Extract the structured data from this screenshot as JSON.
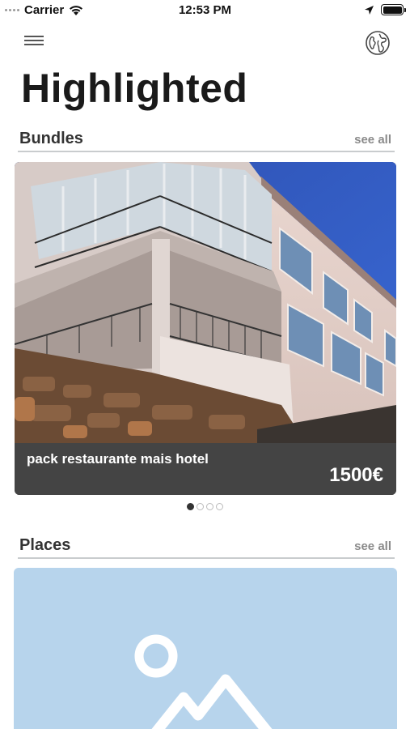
{
  "status_bar": {
    "carrier": "Carrier",
    "time": "12:53 PM"
  },
  "nav": {
    "menu_icon": "hamburger-menu-icon",
    "globe_icon": "globe-icon"
  },
  "page": {
    "title": "Highlighted"
  },
  "bundles": {
    "title": "Bundles",
    "see_all": "see all",
    "items": [
      {
        "name": "pack restaurante mais hotel",
        "price": "1500€"
      }
    ],
    "pager": {
      "count": 4,
      "active": 0
    }
  },
  "places": {
    "title": "Places",
    "see_all": "see all",
    "placeholder_icon": "image-placeholder-icon"
  },
  "colors": {
    "card_footer": "#444444",
    "placeholder_bg": "#b7d4ec",
    "divider": "#c9ccce",
    "see_all": "#8a8a8a"
  }
}
